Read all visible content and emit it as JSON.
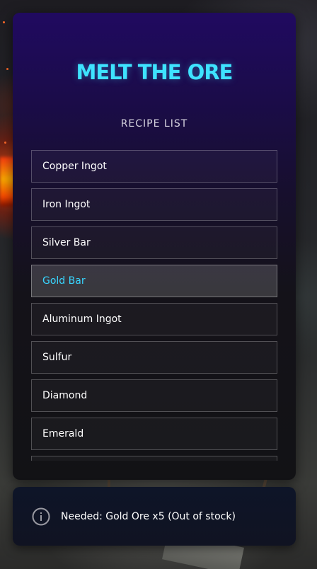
{
  "panel": {
    "title": "MELT THE ORE",
    "list_heading": "RECIPE LIST",
    "selected_recipe": "Gold Bar",
    "recipes": [
      {
        "label": "Copper Ingot"
      },
      {
        "label": "Iron Ingot"
      },
      {
        "label": "Silver Bar"
      },
      {
        "label": "Gold Bar"
      },
      {
        "label": "Aluminum Ingot"
      },
      {
        "label": "Sulfur"
      },
      {
        "label": "Diamond"
      },
      {
        "label": "Emerald"
      },
      {
        "label": ""
      }
    ]
  },
  "status": {
    "icon": "info-icon",
    "message": "Needed: Gold Ore x5 (Out of stock)"
  },
  "colors": {
    "title_accent": "#3ee3ff",
    "selected_text": "#38d6ff",
    "panel_top": "#200a60",
    "panel_bottom": "#121215"
  }
}
